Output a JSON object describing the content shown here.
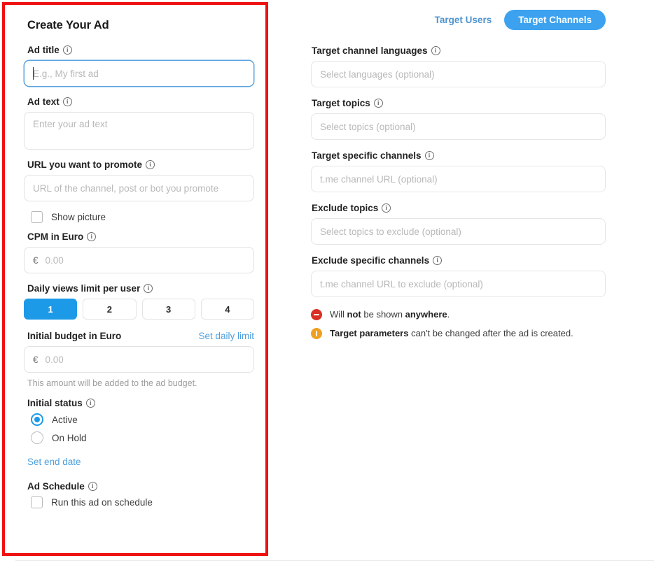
{
  "left_panel": {
    "title": "Create Your Ad",
    "fields": {
      "ad_title": {
        "label": "Ad title",
        "placeholder": "E.g., My first ad",
        "value": "",
        "focused": true
      },
      "ad_text": {
        "label": "Ad text",
        "placeholder": "Enter your ad text",
        "value": ""
      },
      "url": {
        "label": "URL you want to promote",
        "placeholder": "URL of the channel, post or bot you promote",
        "value": ""
      },
      "show_picture": {
        "label": "Show picture",
        "checked": false
      },
      "cpm": {
        "label": "CPM in Euro",
        "currency": "€",
        "placeholder": "0.00",
        "value": ""
      },
      "daily_views_limit": {
        "label": "Daily views limit per user",
        "options": [
          "1",
          "2",
          "3",
          "4"
        ],
        "selected": "1"
      },
      "initial_budget": {
        "label": "Initial budget in Euro",
        "action_link": "Set daily limit",
        "currency": "€",
        "placeholder": "0.00",
        "value": "",
        "hint": "This amount will be added to the ad budget."
      },
      "initial_status": {
        "label": "Initial status",
        "options": [
          "Active",
          "On Hold"
        ],
        "selected": "Active",
        "end_date_link": "Set end date"
      },
      "ad_schedule": {
        "label": "Ad Schedule",
        "checkbox_label": "Run this ad on schedule",
        "checked": false
      }
    },
    "info_icon": "info-icon",
    "highlight_color": "#ee1111"
  },
  "right_panel": {
    "tabs": [
      {
        "label": "Target Users",
        "active": false
      },
      {
        "label": "Target Channels",
        "active": true
      }
    ],
    "fields": [
      {
        "label": "Target channel languages",
        "placeholder": "Select languages (optional)",
        "value": ""
      },
      {
        "label": "Target topics",
        "placeholder": "Select topics (optional)",
        "value": ""
      },
      {
        "label": "Target specific channels",
        "placeholder": "t.me channel URL (optional)",
        "value": ""
      },
      {
        "label": "Exclude topics",
        "placeholder": "Select topics to exclude (optional)",
        "value": ""
      },
      {
        "label": "Exclude specific channels",
        "placeholder": "t.me channel URL to exclude (optional)",
        "value": ""
      }
    ],
    "notes": [
      {
        "icon": "block-icon",
        "color": "#d93025",
        "parts": [
          {
            "text": "Will ",
            "bold": false
          },
          {
            "text": "not",
            "bold": true
          },
          {
            "text": " be shown ",
            "bold": false
          },
          {
            "text": "anywhere",
            "bold": true
          },
          {
            "text": ".",
            "bold": false
          }
        ]
      },
      {
        "icon": "warning-icon",
        "color": "#f0a020",
        "parts": [
          {
            "text": "Target parameters",
            "bold": true
          },
          {
            "text": " can't be changed after the ad is created.",
            "bold": false
          }
        ]
      }
    ]
  },
  "colors": {
    "accent_blue": "#1c9ae8",
    "tab_blue": "#3ca2ef",
    "link_blue": "#4d9fdd",
    "highlight_red": "#ee1111",
    "error_red": "#d93025",
    "warning_orange": "#f0a020"
  }
}
